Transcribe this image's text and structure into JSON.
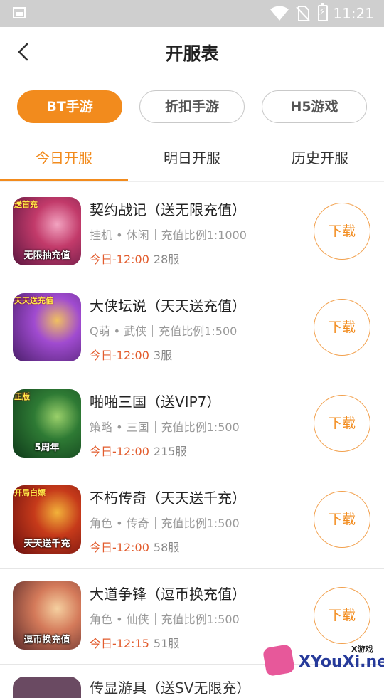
{
  "status_bar": {
    "time": "11:21"
  },
  "header": {
    "title": "开服表"
  },
  "categories": [
    {
      "label": "BT手游",
      "active": true
    },
    {
      "label": "折扣手游",
      "active": false
    },
    {
      "label": "H5游戏",
      "active": false
    }
  ],
  "tabs": [
    {
      "label": "今日开服",
      "active": true
    },
    {
      "label": "明日开服",
      "active": false
    },
    {
      "label": "历史开服",
      "active": false
    }
  ],
  "download_label": "下载",
  "games": [
    {
      "name": "契约战记（送无限充值）",
      "genre": "挂机 • 休闲",
      "ratio": "充值比例1:1000",
      "time": "今日-12:00",
      "server": "28服",
      "icon_text": "无限抽充值",
      "icon_badge": "送首充",
      "colors": [
        "#5a1640",
        "#c23a6a",
        "#f2a3c0"
      ]
    },
    {
      "name": "大侠坛说（天天送充值）",
      "genre": "Q萌 • 武侠",
      "ratio": "充值比例1:500",
      "time": "今日-12:00",
      "server": "3服",
      "icon_text": "",
      "icon_badge": "天天送充值",
      "colors": [
        "#4a1e6a",
        "#a04bd0",
        "#f0c060"
      ]
    },
    {
      "name": "啪啪三国（送VIP7）",
      "genre": "策略 • 三国",
      "ratio": "充值比例1:500",
      "time": "今日-12:00",
      "server": "215服",
      "icon_text": "5周年",
      "icon_badge": "正版",
      "colors": [
        "#0f3a1a",
        "#2e7a34",
        "#9ad06a"
      ]
    },
    {
      "name": "不朽传奇（天天送千充）",
      "genre": "角色 • 传奇",
      "ratio": "充值比例1:500",
      "time": "今日-12:00",
      "server": "58服",
      "icon_text": "天天送千充",
      "icon_badge": "开局白嫖",
      "colors": [
        "#6a0f0f",
        "#c63a1a",
        "#f2b23a"
      ]
    },
    {
      "name": "大道争锋（逗币换充值）",
      "genre": "角色 • 仙侠",
      "ratio": "充值比例1:500",
      "time": "今日-12:15",
      "server": "51服",
      "icon_text": "逗币换充值",
      "icon_badge": "",
      "colors": [
        "#5a2a2a",
        "#d47a5a",
        "#f5d0a0"
      ]
    }
  ],
  "partial_game": {
    "name": "传显游具（送SV无限充）"
  },
  "watermark": {
    "small": "X游戏",
    "text": "XYouXi.net"
  }
}
